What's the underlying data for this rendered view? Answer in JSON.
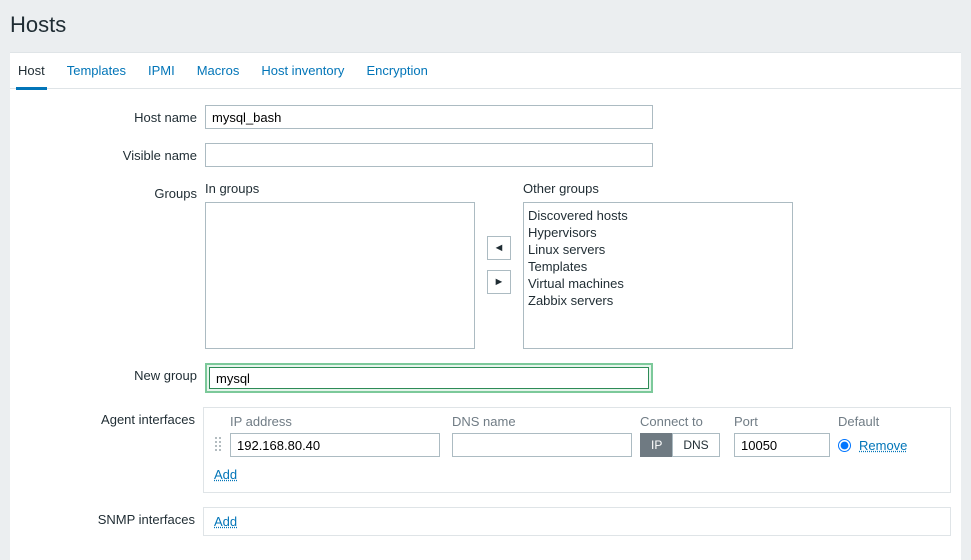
{
  "page": {
    "title": "Hosts"
  },
  "tabs": [
    {
      "label": "Host",
      "active": true
    },
    {
      "label": "Templates"
    },
    {
      "label": "IPMI"
    },
    {
      "label": "Macros"
    },
    {
      "label": "Host inventory"
    },
    {
      "label": "Encryption"
    }
  ],
  "labels": {
    "host_name": "Host name",
    "visible_name": "Visible name",
    "groups": "Groups",
    "in_groups": "In groups",
    "other_groups": "Other groups",
    "new_group": "New group",
    "agent_interfaces": "Agent interfaces",
    "snmp_interfaces": "SNMP interfaces",
    "ip_address": "IP address",
    "dns_name": "DNS name",
    "connect_to": "Connect to",
    "port": "Port",
    "default": "Default",
    "ip": "IP",
    "dns": "DNS",
    "add": "Add",
    "remove": "Remove"
  },
  "values": {
    "host_name": "mysql_bash",
    "visible_name": "",
    "new_group": "mysql"
  },
  "in_groups": [],
  "other_groups": [
    "Discovered hosts",
    "Hypervisors",
    "Linux servers",
    "Templates",
    "Virtual machines",
    "Zabbix servers"
  ],
  "agent_interface": {
    "ip": "192.168.80.40",
    "dns": "",
    "connect_to": "IP",
    "port": "10050",
    "default": true
  },
  "colors": {
    "link": "#0275b8",
    "accent": "#7cc99a",
    "header_bg": "#ebeef0"
  },
  "icons": {
    "move_left": "◄",
    "move_right": "►"
  }
}
